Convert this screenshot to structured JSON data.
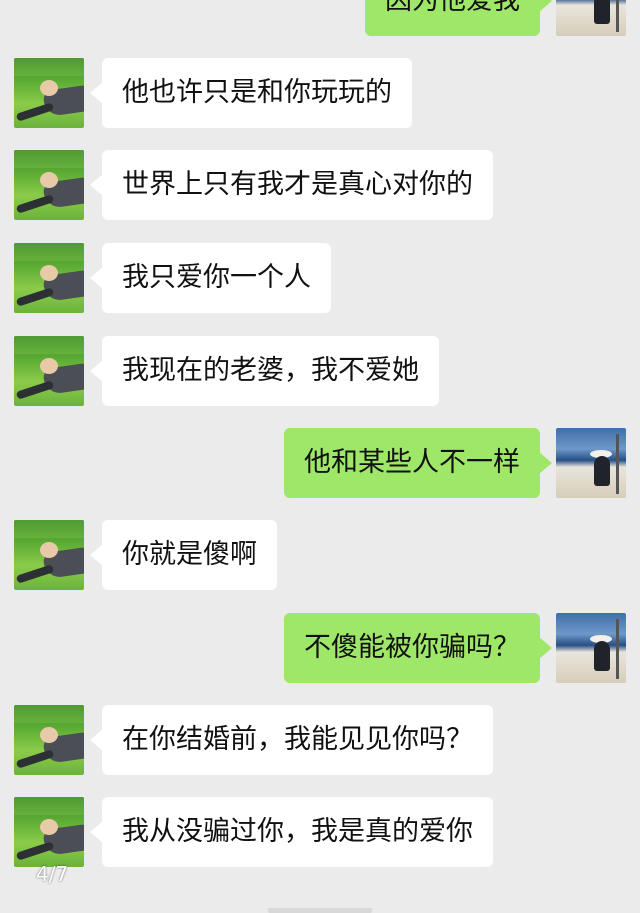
{
  "colors": {
    "background": "#ebebeb",
    "sent_bubble": "#9fe768",
    "received_bubble": "#ffffff"
  },
  "contact_avatar_icon": "grass-lying-man-avatar",
  "self_avatar_icon": "beach-woman-avatar",
  "messages": [
    {
      "side": "right",
      "text": "因为他爱我"
    },
    {
      "side": "left",
      "text": "他也许只是和你玩玩的"
    },
    {
      "side": "left",
      "text": "世界上只有我才是真心对你的"
    },
    {
      "side": "left",
      "text": "我只爱你一个人"
    },
    {
      "side": "left",
      "text": "我现在的老婆，我不爱她"
    },
    {
      "side": "right",
      "text": "他和某些人不一样"
    },
    {
      "side": "left",
      "text": "你就是傻啊"
    },
    {
      "side": "right",
      "text": "不傻能被你骗吗？"
    },
    {
      "side": "left",
      "text": "在你结婚前，我能见见你吗？"
    },
    {
      "side": "left",
      "text": "我从没骗过你，我是真的爱你"
    }
  ],
  "page_indicator": "4/7"
}
